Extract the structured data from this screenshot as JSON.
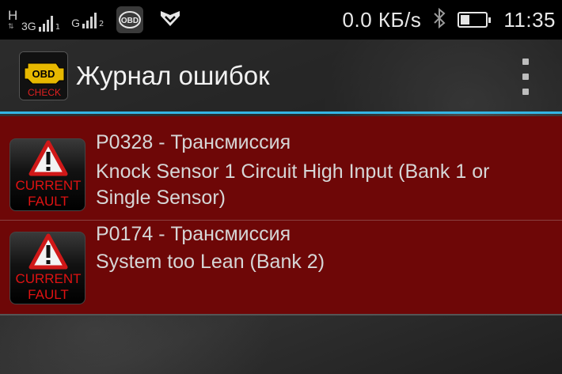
{
  "status_bar": {
    "network1": {
      "type": "3G",
      "sim": "1",
      "h_label": "H"
    },
    "network2": {
      "type": "G",
      "sim": "2"
    },
    "obd_badge": "OBD",
    "data_rate": "0.0 КБ/s",
    "time": "11:35",
    "battery_level": 0.35,
    "icons": [
      "signal-icon",
      "obd-icon",
      "shield-icon",
      "bluetooth-icon",
      "battery-icon"
    ]
  },
  "action_bar": {
    "title": "Журнал ошибок",
    "app_icon_text_top": "OBD",
    "app_icon_text_bottom": "CHECK",
    "overflow_icon": "overflow-menu-icon",
    "divider_color": "#33b5e5"
  },
  "faults": [
    {
      "code": "P0328 - Трансмиссия",
      "description": "Knock Sensor 1 Circuit High Input (Bank 1 or Single Sensor)",
      "badge_line1": "CURRENT",
      "badge_line2": "FAULT"
    },
    {
      "code": "P0174 - Трансмиссия",
      "description": "System too Lean (Bank 2)",
      "badge_line1": "CURRENT",
      "badge_line2": "FAULT"
    }
  ],
  "colors": {
    "row_background": "#6e0707",
    "fault_label": "#e01212",
    "warning_triangle": "#d01818"
  }
}
